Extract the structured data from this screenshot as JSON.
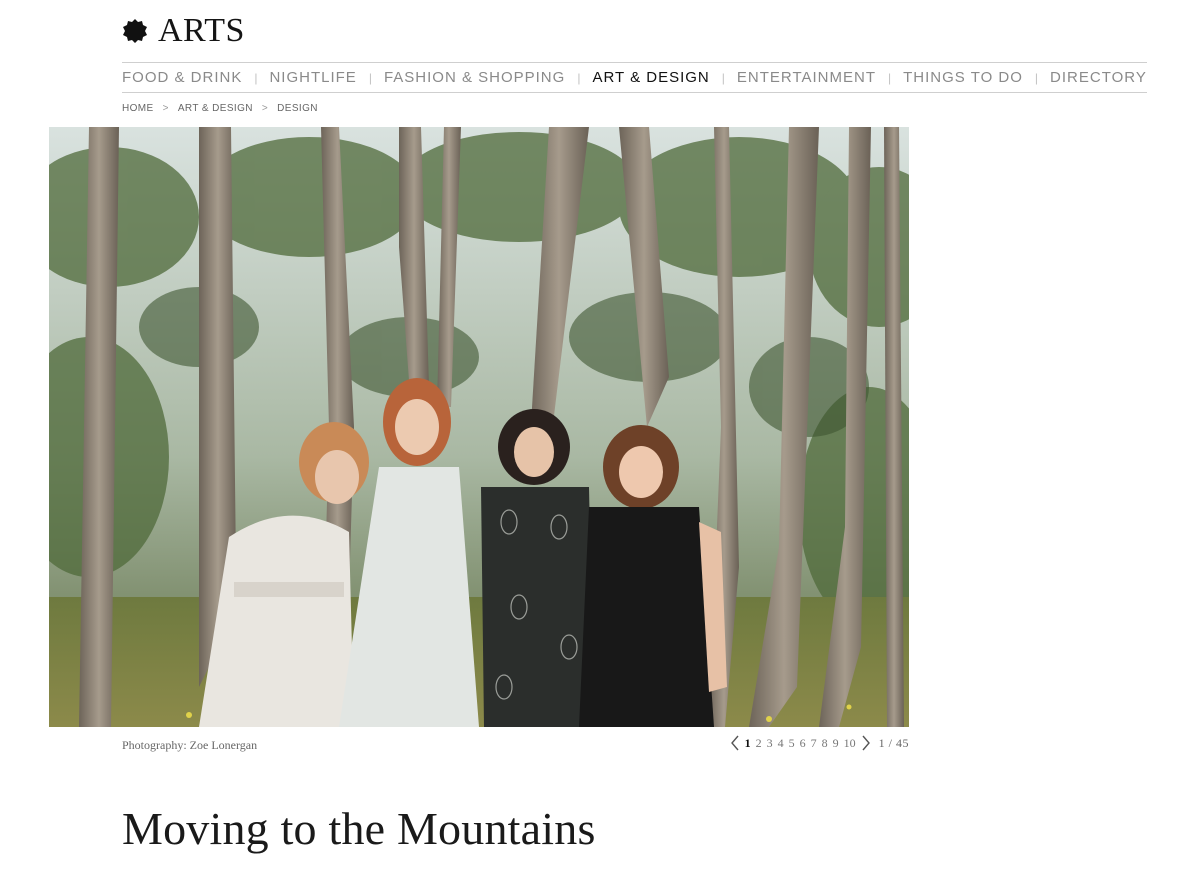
{
  "section": {
    "title": "ARTS",
    "icon": "blot-logo-icon"
  },
  "nav": {
    "items": [
      {
        "label": "FOOD & DRINK",
        "active": false
      },
      {
        "label": "NIGHTLIFE",
        "active": false
      },
      {
        "label": "FASHION & SHOPPING",
        "active": false
      },
      {
        "label": "ART & DESIGN",
        "active": true
      },
      {
        "label": "ENTERTAINMENT",
        "active": false
      },
      {
        "label": "THINGS TO DO",
        "active": false
      },
      {
        "label": "DIRECTORY",
        "active": false
      }
    ]
  },
  "breadcrumb": {
    "items": [
      "HOME",
      "ART & DESIGN",
      "DESIGN"
    ],
    "separator": ">"
  },
  "gallery": {
    "caption": "Photography: Zoe Lonergan",
    "pages": [
      "1",
      "2",
      "3",
      "4",
      "5",
      "6",
      "7",
      "8",
      "9",
      "10"
    ],
    "current_page": "1",
    "count": "1 / 45",
    "prev_icon": "chevron-left-icon",
    "next_icon": "chevron-right-icon"
  },
  "article": {
    "title": "Moving to the Mountains"
  },
  "colors": {
    "active_nav": "#111111",
    "nav": "#8a8a8a",
    "rule": "#cfcfcf"
  }
}
